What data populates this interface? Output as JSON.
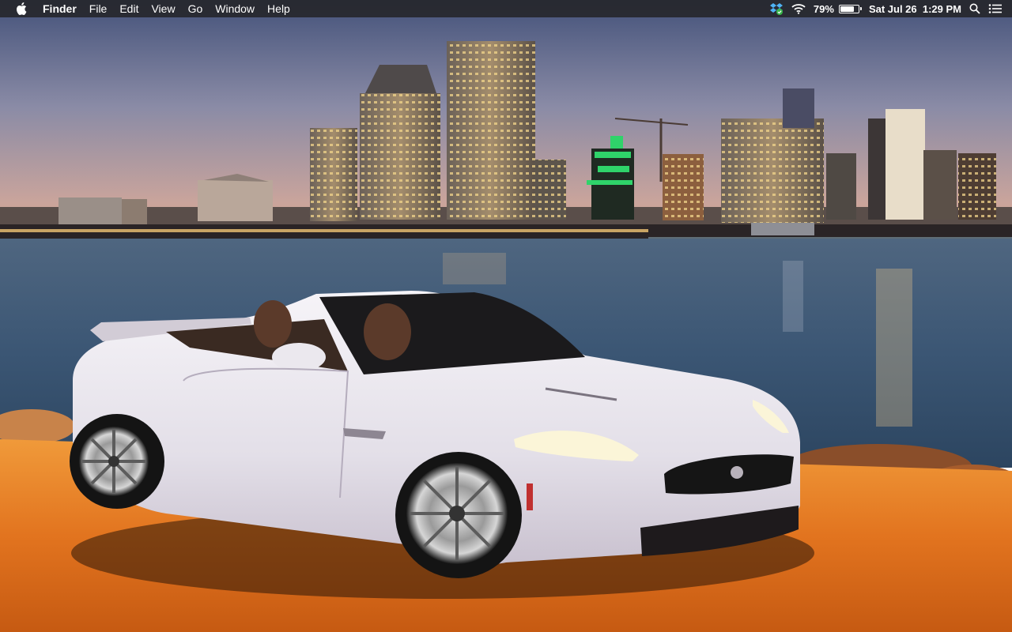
{
  "menubar": {
    "apple_icon": "apple-logo-icon",
    "app_name": "Finder",
    "menus": [
      "File",
      "Edit",
      "View",
      "Go",
      "Window",
      "Help"
    ],
    "status": {
      "dropbox_icon": "dropbox-icon",
      "wifi_icon": "wifi-icon",
      "battery_percent_label": "79%",
      "battery_level": 0.79,
      "date_time": "Sat Jul 26  1:29 PM",
      "spotlight_icon": "search-icon",
      "notification_icon": "notification-center-icon"
    }
  },
  "desktop": {
    "wallpaper": "white convertible sports car parked on a waterfront at dusk with a lit city skyline across the bay"
  },
  "colors": {
    "menubar_bg": "#242428",
    "sky_top": "#4a5a7a",
    "sky_horizon": "#c9a7a0",
    "water": "#3e5670",
    "pavement": "#e0701f",
    "car_body": "#e9e6ee"
  }
}
